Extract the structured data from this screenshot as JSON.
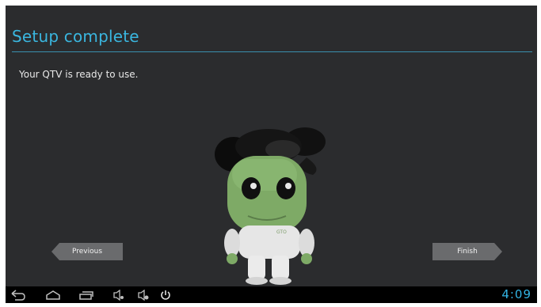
{
  "screen": {
    "title": "Setup complete",
    "message": "Your QTV is ready to use.",
    "accent_color": "#33b5e5"
  },
  "mascot": {
    "shirt_text": "GTO"
  },
  "buttons": {
    "previous_label": "Previous",
    "finish_label": "Finish"
  },
  "navbar": {
    "icons": [
      "back-icon",
      "home-icon",
      "recent-apps-icon",
      "volume-down-icon",
      "volume-up-icon",
      "power-icon"
    ],
    "clock": "4:09"
  }
}
